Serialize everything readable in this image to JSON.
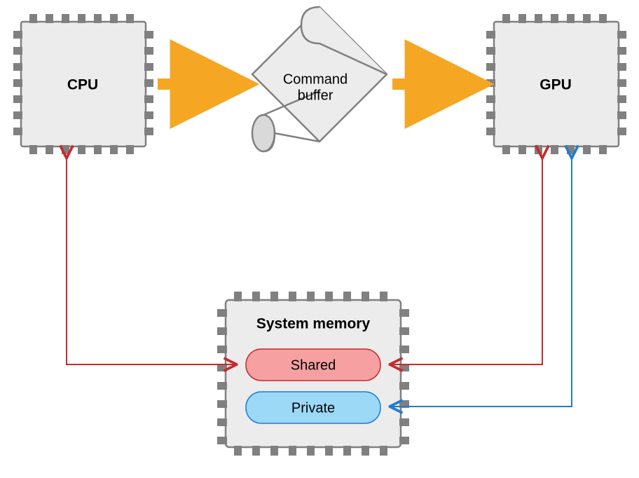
{
  "diagram": {
    "cpu_label": "CPU",
    "gpu_label": "GPU",
    "scroll": {
      "line1": "Command",
      "line2": "buffer"
    },
    "memory": {
      "title": "System memory",
      "shared": "Shared",
      "private": "Private"
    }
  }
}
